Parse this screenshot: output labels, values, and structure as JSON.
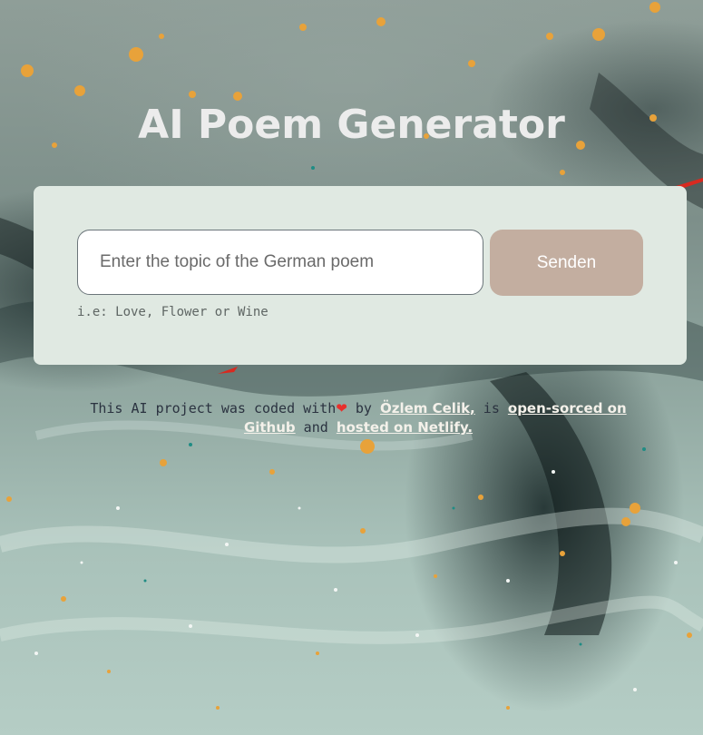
{
  "page": {
    "title": "AI Poem Generator"
  },
  "form": {
    "input_placeholder": "Enter the topic of the German poem",
    "input_value": "",
    "submit_label": "Senden",
    "hint": "i.e: Love, Flower or Wine"
  },
  "footer": {
    "text_before_heart": "This AI project was coded with",
    "heart_icon": "heart-icon",
    "heart_glyph": "❤",
    "text_by": " by ",
    "author_link": "Özlem Celik,",
    "text_is": " is ",
    "github_link": "open-sorced on Github",
    "text_and": " and ",
    "netlify_link": "hosted on Netlify."
  },
  "colors": {
    "title": "#ececec",
    "card_background": "#e0e9e2",
    "button_background": "#c3aea0",
    "heart": "#e8302c",
    "link": "#f4f1ea"
  }
}
